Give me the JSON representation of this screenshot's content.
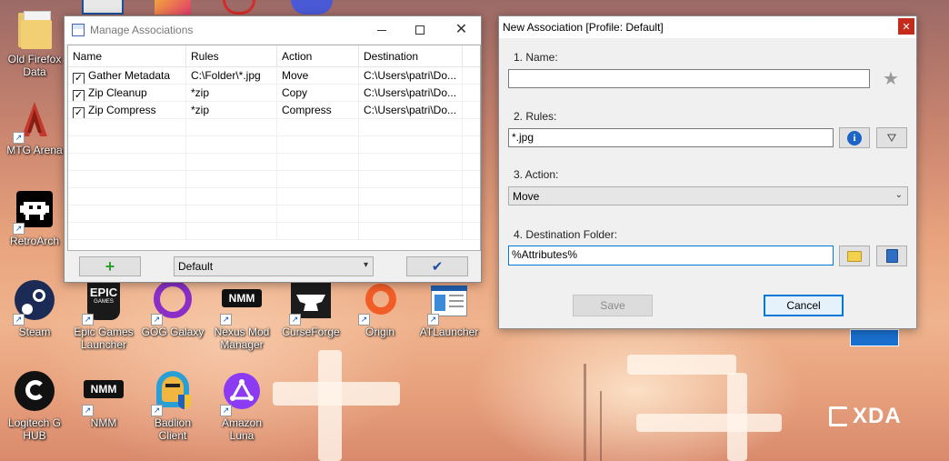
{
  "desktop": {
    "icons": [
      {
        "label": "Old Firefox",
        "label2": "Data",
        "icon": "folder-icon"
      },
      {
        "label": "MTG Arena",
        "icon": "mtg-arena-icon"
      },
      {
        "label": "RetroArch",
        "icon": "retroarch-icon"
      },
      {
        "label": "Steam",
        "icon": "steam-icon"
      },
      {
        "label": "Epic Games",
        "label2": "Launcher",
        "icon": "epic-games-icon",
        "logo_text": "EPIC",
        "logo_sub": "GAMES"
      },
      {
        "label": "GOG Galaxy",
        "icon": "gog-galaxy-icon"
      },
      {
        "label": "Nexus Mod",
        "label2": "Manager",
        "icon": "nexus-mod-manager-icon",
        "logo_text": "NMM"
      },
      {
        "label": "CurseForge",
        "icon": "curseforge-icon"
      },
      {
        "label": "Origin",
        "icon": "origin-icon"
      },
      {
        "label": "ATLauncher",
        "icon": "atlauncher-icon"
      },
      {
        "label": "Logitech G",
        "label2": "HUB",
        "icon": "logitech-g-hub-icon"
      },
      {
        "label": "NMM",
        "icon": "nmm-icon",
        "logo_text": "NMM"
      },
      {
        "label": "Badlion",
        "label2": "Client",
        "icon": "badlion-client-icon"
      },
      {
        "label": "Amazon",
        "label2": "Luna",
        "icon": "amazon-luna-icon"
      }
    ],
    "watermark": "XDA"
  },
  "manage_window": {
    "title": "Manage Associations",
    "columns": [
      "Name",
      "Rules",
      "Action",
      "Destination"
    ],
    "rows": [
      {
        "checked": true,
        "name": "Gather Metadata",
        "rules": "C:\\Folder\\*.jpg",
        "action": "Move",
        "destination": "C:\\Users\\patri\\Do..."
      },
      {
        "checked": true,
        "name": "Zip Cleanup",
        "rules": "*zip",
        "action": "Copy",
        "destination": "C:\\Users\\patri\\Do..."
      },
      {
        "checked": true,
        "name": "Zip Compress",
        "rules": "*zip",
        "action": "Compress",
        "destination": "C:\\Users\\patri\\Do..."
      }
    ],
    "profile_select": "Default"
  },
  "new_window": {
    "title": "New Association [Profile: Default]",
    "name_label": "1. Name:",
    "name_value": "",
    "rules_label": "2. Rules:",
    "rules_value": "*.jpg",
    "action_label": "3. Action:",
    "action_value": "Move",
    "dest_label": "4. Destination Folder:",
    "dest_value": "%Attributes%",
    "save_label": "Save",
    "cancel_label": "Cancel"
  },
  "colors": {
    "accent": "#0078d7",
    "close_red": "#c42b1c",
    "add_green": "#2e9e2e",
    "check_blue": "#1f4fa0"
  }
}
